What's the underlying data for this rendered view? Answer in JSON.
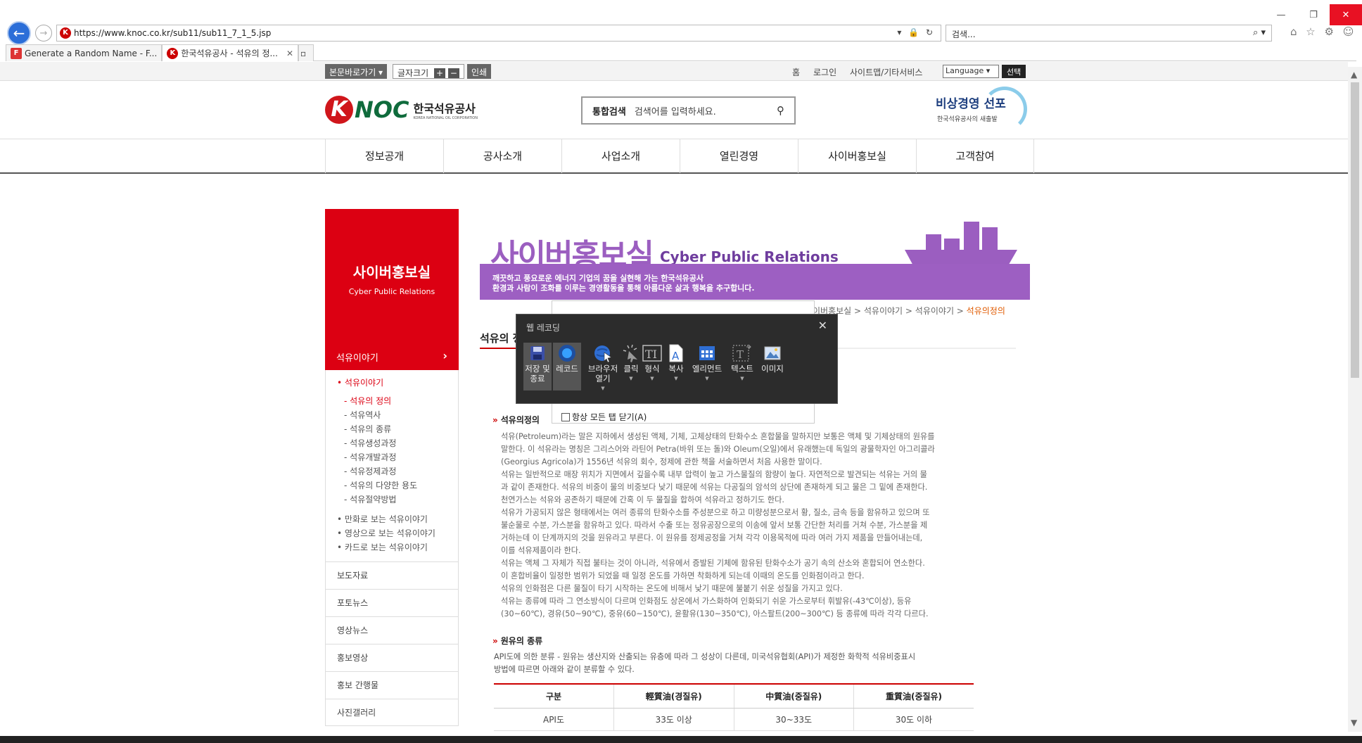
{
  "browser": {
    "url": "https://www.knoc.co.kr/sub11/sub11_7_1_5.jsp",
    "search_placeholder": "검색...",
    "tabs": [
      {
        "label": "Generate a Random Name - F..."
      },
      {
        "label": "한국석유공사 - 석유의 정..."
      }
    ]
  },
  "utility": {
    "skip_label": "본문바로가기 ▾",
    "font_size_label": "글자크기",
    "print_label": "인쇄",
    "links": [
      "홈",
      "로그인",
      "사이트맵/기타서비스"
    ],
    "language_select": "Language",
    "language_button": "선택"
  },
  "header": {
    "logo_text": "NOC",
    "logo_ko": "한국석유공사",
    "logo_en": "KOREA NATIONAL OIL CORPORATION",
    "search_label": "통합검색",
    "search_placeholder": "검색어를 입력하세요.",
    "banner_title": "비상경영 선포",
    "banner_sub": "한국석유공사의 새출발"
  },
  "gnb": [
    "정보공개",
    "공사소개",
    "사업소개",
    "열린경영",
    "사이버홍보실",
    "고객참여"
  ],
  "lnb": {
    "title": "사이버홍보실",
    "subtitle": "Cyber Public Relations",
    "active": "석유이야기",
    "group_label": "석유이야기",
    "children": [
      "석유의 정의",
      "석유역사",
      "석유의 종류",
      "석유생성과정",
      "석유개발과정",
      "석유정제과정",
      "석유의 다양한 용도",
      "석유절약방법"
    ],
    "extra": [
      "만화로 보는 석유이야기",
      "영상으로 보는 석유이야기",
      "카드로 보는 석유이야기"
    ],
    "menus": [
      "보도자료",
      "포토뉴스",
      "영상뉴스",
      "홍보영상",
      "홍보 간행물",
      "사진갤러리"
    ]
  },
  "visual": {
    "title": "사이버홍보실",
    "title_en": "Cyber Public Relations",
    "line1": "깨끗하고 풍요로운 에너지 기업의 꿈을 실현해 가는 한국석유공사",
    "line2": "환경과 사람이 조화를 이루는 경영활동을 통해 아름다운 삶과 행복을 추구합니다."
  },
  "breadcrumb": {
    "items": [
      "이버홍보실",
      "석유이야기",
      "석유이야기"
    ],
    "current": "석유의정의"
  },
  "content": {
    "title": "석유의 정",
    "section1": "석유의정의",
    "paragraphs": [
      "석유(Petroleum)라는 말은 지하에서 생성된 액체, 기체, 고체상태의 탄화수소 혼합물을 말하지만 보통은 액체 및 기체상태의 원유를",
      "말한다. 이 석유라는 명칭은 그리스어와 라틴어 Petra(바위 또는 돌)와 Oleum(오일)에서 유래했는데 독일의 광물학자인 아그리콜라",
      "(Georgius Agricola)가 1556년 석유의 회수, 정제에 관한 책을 서술하면서 처음 사용한 말이다.",
      "석유는 일반적으로 매장 위치가 지면에서 깊을수록 내부 압력이 높고 가스물질의 함량이 높다. 자연적으로 발견되는 석유는 거의 물",
      "과 같이 존재한다. 석유의 비중이 물의 비중보다 낮기 때문에 석유는 다공질의 암석의 상단에 존재하게 되고 물은 그 밑에 존재한다.",
      "천연가스는 석유와 공존하기 때문에 간혹 이 두 물질을 합하여 석유라고 정하기도 한다.",
      "석유가 가공되지 않은 형태에서는 여러 종류의 탄화수소를 주성분으로 하고 미량성분으로서 황, 질소, 금속 등을 함유하고 있으며 또",
      "불순물로 수분, 가스분을 함유하고 있다. 따라서 수출 또는 정유공장으로의 이송에 앞서 보통 간단한 처리를 거쳐 수분, 가스분을 제",
      "거하는데 이 단계까지의 것을 원유라고 부른다. 이 원유를 정제공정을 거쳐 각각 이용목적에 따라 여러 가지 제품을 만들어내는데,",
      "이를 석유제품이라 한다.",
      "석유는 액체 그 자체가 직접 불타는 것이 아니라, 석유에서 증발된 기체에 함유된 탄화수소가 공기 속의 산소와 혼합되어 연소한다.",
      "이 혼합비율이 일정한 범위가 되었을 때 일정 온도를 가하면 착화하게 되는데 이때의 온도를 인화점이라고 한다.",
      "석유의 인화점은 다른 물질이 타기 시작하는 온도에 비해서 낮기 때문에 불붙기 쉬운 성질을 가지고 있다.",
      "석유는 종류에 따라 그 연소방식이 다르며 인화점도 상온에서 가스화하여 인화되기 쉬운 가스로부터 휘발유(-43℃이상), 등유",
      "(30~60℃), 경유(50~90℃), 중유(60~150℃), 윤활유(130~350℃), 아스팔트(200~300℃) 등 종류에 따라 각각 다르다."
    ],
    "section2": "원유의 종류",
    "crude_desc": [
      "API도에 의한 분류 - 원유는 생산지와 산출되는 유층에 따라 그 성상이 다른데, 미국석유협회(API)가 제정한 화학적 석유비중표시",
      "방법에 따르면 아래와 같이 분류할 수 있다."
    ],
    "table": {
      "headers": [
        "구분",
        "輕質油(경질유)",
        "中質油(중질유)",
        "重質油(중질유)"
      ],
      "row": [
        "API도",
        "33도 이상",
        "30~33도",
        "30도 이하"
      ]
    }
  },
  "recorder": {
    "title": "웹 레코딩",
    "tools": [
      "저장 및 종료",
      "레코드",
      "브라우저 열기",
      "클릭",
      "형식",
      "복사",
      "엘리먼트",
      "텍스트",
      "이미지"
    ],
    "close_all_tabs": "항상 모든 탭 닫기(A)"
  },
  "colors": {
    "brand_red": "#dc0012",
    "purple": "#9d5fc2",
    "logo_green": "#0f6b3c"
  }
}
